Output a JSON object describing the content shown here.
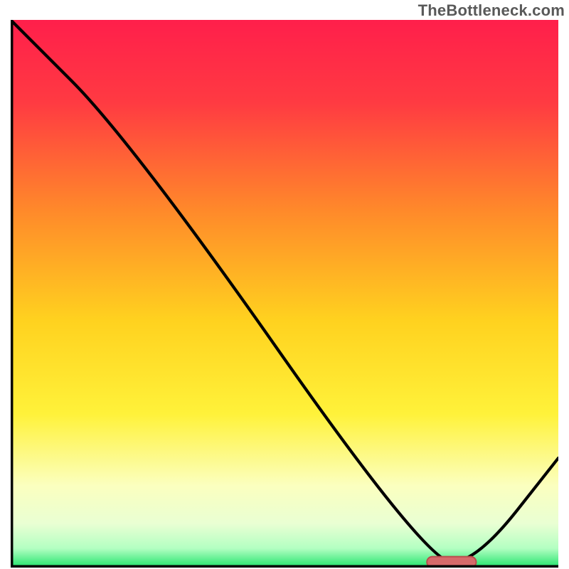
{
  "watermark": "TheBottleneck.com",
  "colors": {
    "gradient_stops": [
      {
        "offset": 0.0,
        "color": "#ff1f4b"
      },
      {
        "offset": 0.15,
        "color": "#ff3a42"
      },
      {
        "offset": 0.35,
        "color": "#ff8a2a"
      },
      {
        "offset": 0.55,
        "color": "#ffd21f"
      },
      {
        "offset": 0.72,
        "color": "#fff23a"
      },
      {
        "offset": 0.85,
        "color": "#fbffbf"
      },
      {
        "offset": 0.92,
        "color": "#e9ffd3"
      },
      {
        "offset": 0.965,
        "color": "#b3ffc2"
      },
      {
        "offset": 1.0,
        "color": "#20e36b"
      }
    ],
    "line": "#000000",
    "axis": "#000000",
    "marker_fill": "#d66a6a",
    "marker_stroke": "#b94c4c"
  },
  "chart_data": {
    "type": "line",
    "title": "",
    "xlabel": "",
    "ylabel": "",
    "xlim": [
      0,
      100
    ],
    "ylim": [
      0,
      100
    ],
    "legend": false,
    "grid": false,
    "annotations": [],
    "series": [
      {
        "name": "curve",
        "x": [
          0,
          22,
          76,
          85,
          100
        ],
        "y": [
          100,
          78,
          1,
          1,
          20
        ]
      }
    ],
    "marker": {
      "name": "highlight-band",
      "x_start": 76,
      "x_end": 85,
      "y": 1,
      "height": 2
    }
  }
}
